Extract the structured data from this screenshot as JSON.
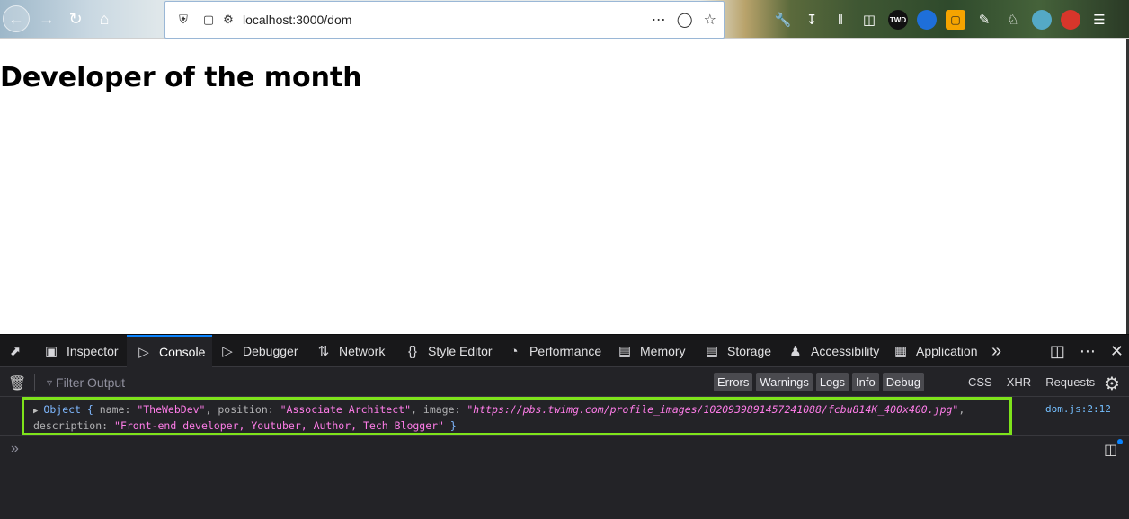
{
  "browser": {
    "url": "localhost:3000/dom",
    "toolbar_icons": [
      "wrench-icon",
      "download-icon",
      "library-icon",
      "sidebar-icon",
      "twd-extension-icon",
      "blue-extension-icon",
      "orange-extension-icon",
      "notes-icon",
      "gnu-icon",
      "globe-extension-icon",
      "red-extension-icon",
      "menu-icon"
    ],
    "twd_label": "TWD"
  },
  "page": {
    "heading": "Developer of the month"
  },
  "devtools": {
    "tabs": [
      {
        "label": "Inspector",
        "icon": "inspector-icon"
      },
      {
        "label": "Console",
        "icon": "console-icon"
      },
      {
        "label": "Debugger",
        "icon": "debugger-icon"
      },
      {
        "label": "Network",
        "icon": "network-icon"
      },
      {
        "label": "Style Editor",
        "icon": "style-editor-icon"
      },
      {
        "label": "Performance",
        "icon": "performance-icon"
      },
      {
        "label": "Memory",
        "icon": "memory-icon"
      },
      {
        "label": "Storage",
        "icon": "storage-icon"
      },
      {
        "label": "Accessibility",
        "icon": "accessibility-icon"
      },
      {
        "label": "Application",
        "icon": "application-icon"
      }
    ],
    "active_tab": "Console",
    "filter_placeholder": "Filter Output",
    "levels": [
      "Errors",
      "Warnings",
      "Logs",
      "Info",
      "Debug"
    ],
    "request_filters": [
      "CSS",
      "XHR",
      "Requests"
    ],
    "log": {
      "prefix": "Object {",
      "name_key": "name:",
      "name_val": "\"TheWebDev\"",
      "position_key": "position:",
      "position_val": "\"Associate Architect\"",
      "image_key": "image:",
      "image_val": "\"https://pbs.twimg.com/profile_images/1020939891457241088/fcbu814K_400x400.jpg\"",
      "description_key": "description:",
      "description_val": "\"Front-end developer, Youtuber, Author, Tech Blogger\"",
      "suffix": "}",
      "source": "dom.js:2:12"
    }
  }
}
